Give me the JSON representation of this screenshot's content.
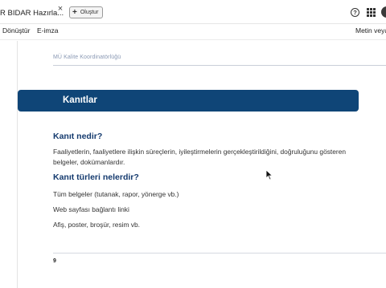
{
  "tabs": {
    "active_title": "R BIDAR Hazırla...",
    "close_glyph": "×",
    "new_button_label": "Oluştur"
  },
  "toolbar": {
    "help_glyph": "?"
  },
  "menu": {
    "items": [
      "Dönüştür",
      "E-imza"
    ],
    "right_label": "Metin veya"
  },
  "document": {
    "header": "MÜ Kalite Koordinatörlüğü",
    "section_title": "Kanıtlar",
    "q1": "Kanıt nedir?",
    "q1_body": "Faaliyetlerin, faaliyetlere ilişkin süreçlerin, iyileştirmelerin gerçekleştirildiğini, doğruluğunu gösteren belgeler, dokümanlardır.",
    "q2": "Kanıt türleri nelerdir?",
    "q2_items": [
      "Tüm belgeler (tutanak, rapor, yönerge vb.)",
      "Web sayfası bağlantı linki",
      "Afiş, poster, broşür, resim vb."
    ],
    "page_number": "9"
  },
  "colors": {
    "band": "#0f4577",
    "heading": "#143a6e",
    "header_text": "#8a99b4"
  }
}
